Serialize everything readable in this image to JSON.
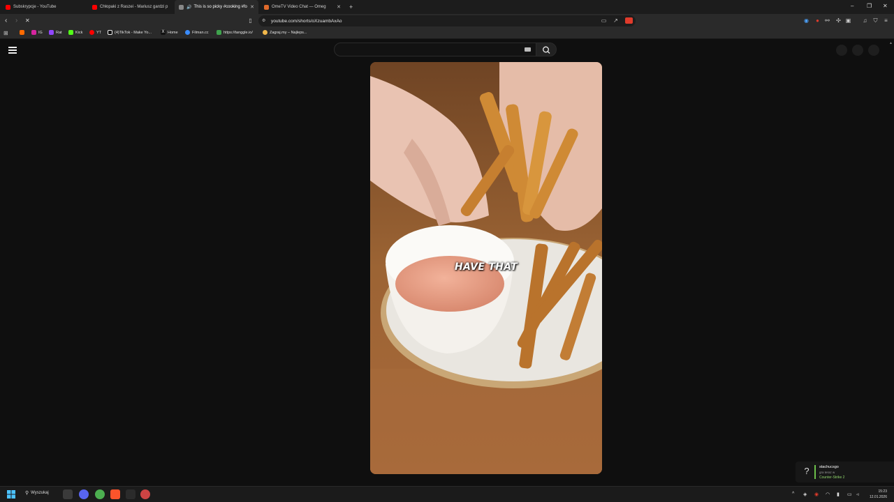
{
  "browser": {
    "tabs": [
      {
        "title": "Subskrypcje - YouTube",
        "color": "#ff0000",
        "active": false
      },
      {
        "title": "Chłopaki z Raszei - Mariusz gardzi p",
        "color": "#ff0000",
        "active": false
      },
      {
        "title": "This is so picky #cooking #fo",
        "color": "#999999",
        "active": true
      },
      {
        "title": "OmeTV Video Chat — Omeg",
        "color": "#e06a2b",
        "active": false
      }
    ],
    "new_tab_label": "+",
    "url": "youtube.com/shorts/oXzuambAxAo",
    "bookmarks": [
      {
        "label": "",
        "color": "#ff6a00"
      },
      {
        "label": "IG",
        "color": "#d6249f"
      },
      {
        "label": "Rat",
        "color": "#9146ff"
      },
      {
        "label": "Kick",
        "color": "#53fc18"
      },
      {
        "label": "YT",
        "color": "#ff0000"
      },
      {
        "label": "(4)TikTok - Make Yo...",
        "color": "#ffffff"
      },
      {
        "label": "Home",
        "color": "#ffffff"
      },
      {
        "label": "Filman.cc",
        "color": "#3a8cff"
      },
      {
        "label": "https://tanggle.io/",
        "color": "#3fa34d"
      },
      {
        "label": "Zagraj.my – Najleps...",
        "color": "#f2b84b"
      }
    ]
  },
  "youtube": {
    "search_placeholder": "",
    "video_caption": "HAVE THAT"
  },
  "notification": {
    "title": "stachucsgo",
    "subtitle": "gra teraz w",
    "game": "Counter-Strike 2"
  },
  "taskbar": {
    "search_label": "Wyszukaj",
    "time": "15:23",
    "date": "12.01.2026"
  }
}
